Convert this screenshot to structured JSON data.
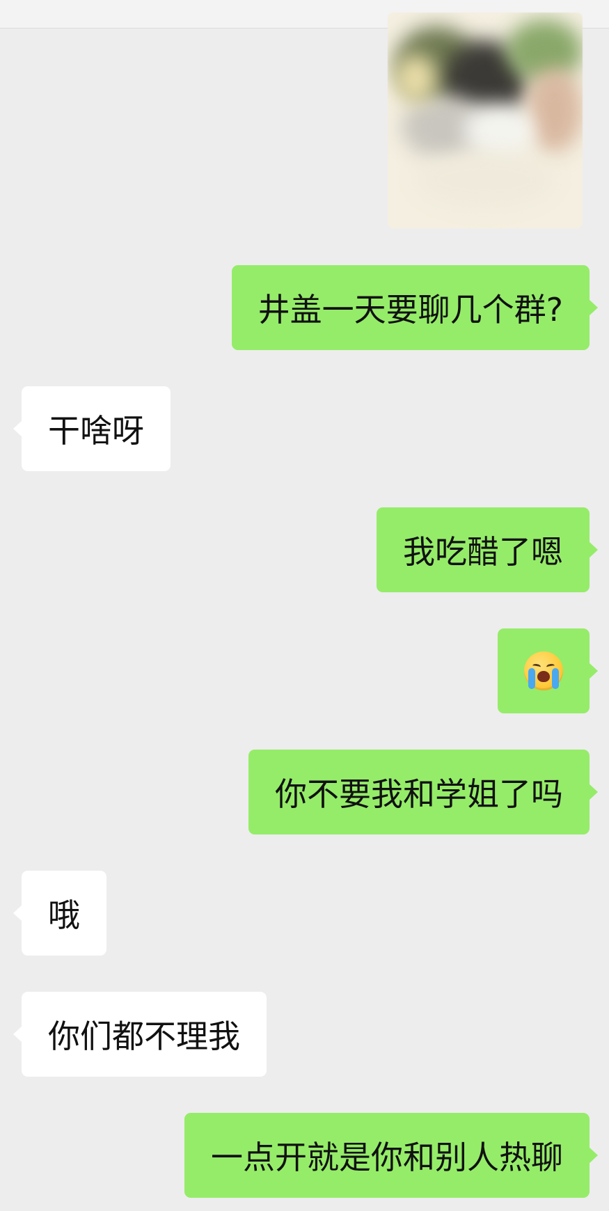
{
  "messages": [
    {
      "id": "m1",
      "sender": "me",
      "text": "井盖一天要聊几个群?"
    },
    {
      "id": "m2",
      "sender": "other",
      "text": "干啥呀"
    },
    {
      "id": "m3",
      "sender": "me",
      "text": "我吃醋了嗯"
    },
    {
      "id": "m4",
      "sender": "me",
      "emoji": "loudly-crying-face"
    },
    {
      "id": "m5",
      "sender": "me",
      "text": "你不要我和学姐了吗"
    },
    {
      "id": "m6",
      "sender": "other",
      "text": "哦"
    },
    {
      "id": "m7",
      "sender": "other",
      "text": "你们都不理我"
    },
    {
      "id": "m8",
      "sender": "me",
      "text": "一点开就是你和别人热聊"
    }
  ],
  "colors": {
    "background": "#ededed",
    "outgoing_bubble": "#95ec69",
    "incoming_bubble": "#ffffff",
    "text": "#111111"
  }
}
